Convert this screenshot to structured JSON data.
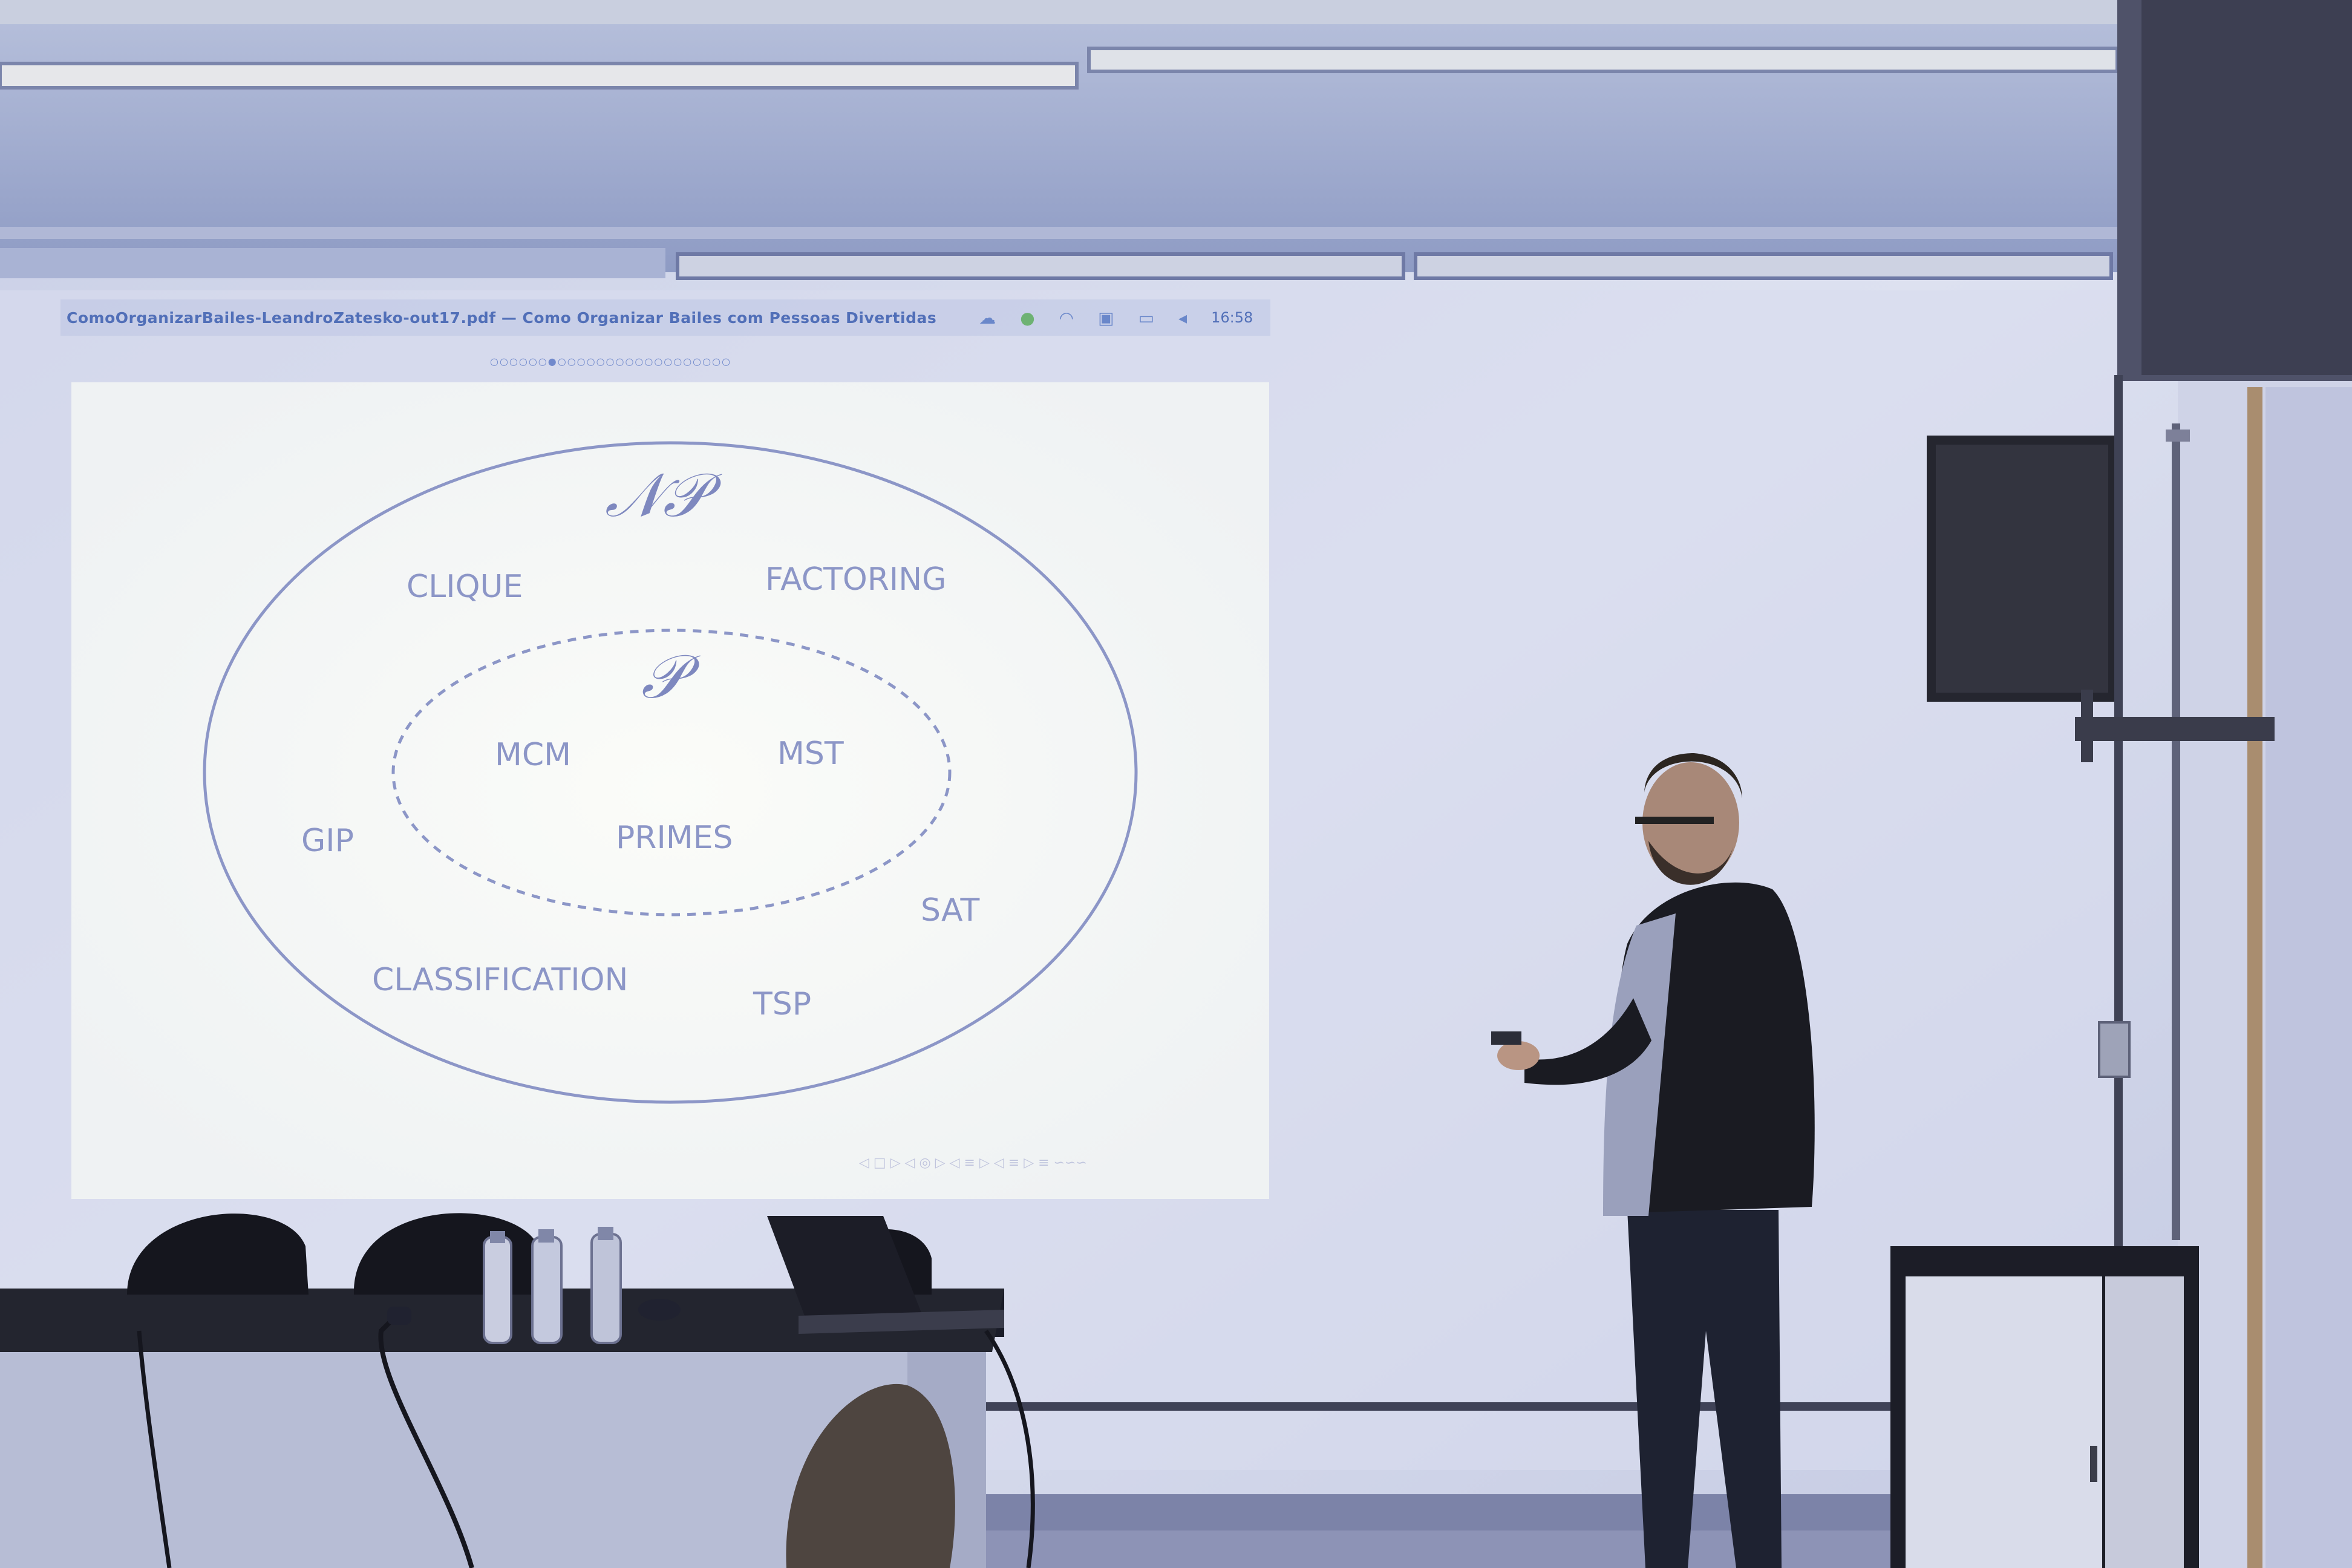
{
  "projection": {
    "window_title": "ComoOrganizarBailes-LeandroZatesko-out17.pdf — Como Organizar Bailes com Pessoas Divertidas",
    "clock": "16:58",
    "tray_icons": [
      "cloud-icon",
      "green-dot-icon",
      "wifi-icon",
      "input-method-icon",
      "battery-icon",
      "volume-icon",
      "gear-icon"
    ],
    "nav_dots": "○○○○○○●○○○○○○○○○○○○○○○○○○"
  },
  "slide": {
    "outer_set_label": "𝒩𝒫",
    "inner_set_label": "𝒫",
    "np_problems": [
      "CLIQUE",
      "FACTORING",
      "GIP",
      "SAT",
      "CLASSIFICATION",
      "TSP"
    ],
    "p_problems": [
      "MCM",
      "MST",
      "PRIMES"
    ],
    "footer_nav": "◁ □ ▷ ◁ ◎ ▷ ◁ ≡ ▷ ◁ ≡ ▷ ≡ ∽∽∽",
    "colors": {
      "background": "#f6f8f6",
      "lines": "#8c96c7"
    }
  }
}
